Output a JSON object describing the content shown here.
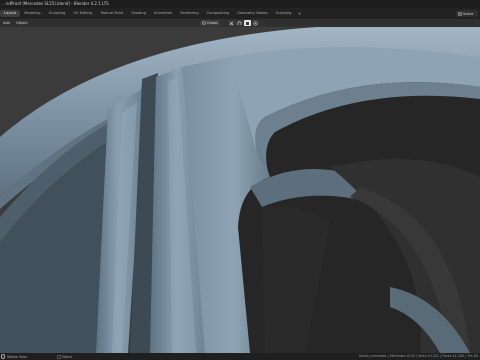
{
  "window": {
    "title": "...ndProof (Mercedes SL55).blend] - Blender 4.2.1 LTS"
  },
  "workspaces": {
    "tabs": [
      {
        "label": "Layout",
        "active": true
      },
      {
        "label": "Modeling",
        "active": false
      },
      {
        "label": "Sculpting",
        "active": false
      },
      {
        "label": "UV Editing",
        "active": false
      },
      {
        "label": "Texture Paint",
        "active": false
      },
      {
        "label": "Shading",
        "active": false
      },
      {
        "label": "Animation",
        "active": false
      },
      {
        "label": "Rendering",
        "active": false
      },
      {
        "label": "Compositing",
        "active": false
      },
      {
        "label": "Geometry Nodes",
        "active": false
      },
      {
        "label": "Scripting",
        "active": false
      }
    ],
    "add_label": "+",
    "scene_label": "Scene"
  },
  "header": {
    "menus": [
      "Add",
      "Object"
    ],
    "transform_orientation": "Global"
  },
  "status": {
    "left_label": "Rotate View",
    "mid_label": "Object",
    "right_text": "Scene_mercedes | Mercedes SL55 | Verts 43,321 | Faces 42,200 | Tris 84,"
  },
  "colors": {
    "wheel_surface": "#7c92a3",
    "wheel_dark": "#4b5b67",
    "wheel_highlight": "#a9bccb",
    "background": "#3a3a3a",
    "rim_interior": "#252525"
  },
  "icons": {
    "scene": "scene-icon",
    "transform": "transform-orientation-icon",
    "snap": "snap-icon",
    "proportional": "proportional-edit-icon",
    "mouse": "mouse-icon",
    "object_mode": "object-mode-icon"
  }
}
